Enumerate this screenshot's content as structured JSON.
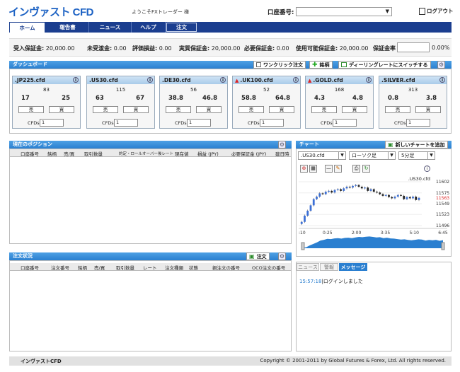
{
  "header": {
    "logo": "インヴァスト CFD",
    "welcome": "ようこそFXトレーダー 様",
    "account_label": "口座番号:",
    "account_value": "",
    "logout": "ログアウト"
  },
  "nav": {
    "tabs": [
      "ホーム",
      "報告書",
      "ニュース",
      "ヘルプ"
    ],
    "order": "注文"
  },
  "summary": [
    {
      "label": "受入保証金:",
      "value": "20,000.00"
    },
    {
      "label": "未受渡金:",
      "value": "0.00"
    },
    {
      "label": "評価損益:",
      "value": "0.00"
    },
    {
      "label": "実質保証金:",
      "value": "20,000.00"
    },
    {
      "label": "必要保証金:",
      "value": "0.00"
    },
    {
      "label": "使用可能保証金:",
      "value": "20,000.00"
    },
    {
      "label": "保証金率",
      "value": "0.00%"
    }
  ],
  "dashboard": {
    "title": "ダッシュボード",
    "one_click": "ワンクリック注文",
    "add": "銘柄",
    "switch_rate": "ディーリングレートにスイッチする",
    "tiles": [
      {
        "symbol": ".JP225.cfd",
        "spread": "83",
        "bid": "17",
        "ask": "25",
        "up": false
      },
      {
        "symbol": ".US30.cfd",
        "spread": "115",
        "bid": "63",
        "ask": "67",
        "up": false
      },
      {
        "symbol": ".DE30.cfd",
        "spread": "56",
        "bid": "38.8",
        "ask": "46.8",
        "up": false
      },
      {
        "symbol": ".UK100.cfd",
        "spread": "52",
        "bid": "58.8",
        "ask": "64.8",
        "up": true
      },
      {
        "symbol": ".GOLD.cfd",
        "spread": "168",
        "bid": "4.3",
        "ask": "4.8",
        "up": true
      },
      {
        "symbol": ".SILVER.cfd",
        "spread": "313",
        "bid": "0.8",
        "ask": "3.8",
        "up": false
      }
    ],
    "sell": "売",
    "buy": "買",
    "cfds_label": "CFDs",
    "cfds_value": "1"
  },
  "positions": {
    "title": "現在のポジション",
    "columns": [
      "口座番号",
      "銘柄",
      "売/買",
      "取引数量",
      "約定・ロールオーバー後レート",
      "現在値",
      "損益 (JPY)",
      "必要保証金 (JPY)",
      "建日時"
    ]
  },
  "orders": {
    "title": "注文状況",
    "order_button": "注文",
    "columns": [
      "口座番号",
      "注文番号",
      "銘柄",
      "売/買",
      "取引数量",
      "レート",
      "注文種類",
      "状態",
      "親注文の番号",
      "OCO注文の番号"
    ]
  },
  "chart": {
    "title": "チャート",
    "add_chart": "新しいチャートを追加",
    "symbol": ".US30.cfd",
    "candle_type": "ローソク足",
    "interval": "5分足",
    "label": ".US30.cfd",
    "current_price": "11563",
    "y_ticks": [
      "11602",
      "11575",
      "11549",
      "11523",
      "11496"
    ],
    "x_ticks": [
      ":10",
      "0:25",
      "2:00",
      "3:35",
      "5:10",
      "6:45"
    ],
    "chart_data": {
      "type": "line",
      "x": [
        0,
        1,
        2,
        3,
        4,
        5,
        6,
        7,
        8,
        9,
        10,
        11,
        12,
        13,
        14,
        15,
        16,
        17,
        18,
        19,
        20,
        21,
        22,
        23,
        24,
        25,
        26,
        27,
        28,
        29,
        30,
        31,
        32,
        33,
        34,
        35,
        36,
        37,
        38,
        39,
        40
      ],
      "series": [
        {
          "values": [
            11500,
            11505,
            11520,
            11532,
            11545,
            11560,
            11566,
            11574,
            11572,
            11578,
            11580,
            11576,
            11582,
            11584,
            11580,
            11586,
            11590,
            11588,
            11592,
            11594,
            11590,
            11586,
            11588,
            11580,
            11584,
            11578,
            11576,
            11572,
            11568,
            11570,
            11565,
            11562,
            11566,
            11570,
            11568,
            11560,
            11565,
            11562,
            11566,
            11558,
            11563
          ]
        }
      ],
      "ylim": [
        11496,
        11602
      ]
    }
  },
  "messages": {
    "tabs": [
      "ニュース",
      "警報",
      "メッセージ"
    ],
    "active": 2,
    "items": [
      {
        "time": "15:57:18",
        "text": "|ログインしました"
      }
    ]
  },
  "footer": {
    "brand": "インヴァストCFD",
    "copyright": "Copyright © 2001-2011 by Global Futures & Forex, Ltd. All rights reserved."
  },
  "colors": {
    "accent": "#1b3e8f",
    "section": "#2a7fd0",
    "up": "#dd2222"
  }
}
